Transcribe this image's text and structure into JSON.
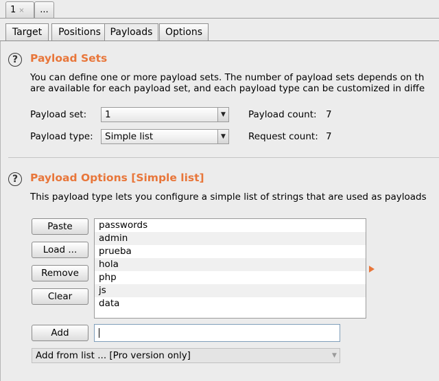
{
  "attack_tabs": [
    {
      "label": "1",
      "close": "×"
    },
    {
      "label": "..."
    }
  ],
  "tabs": [
    {
      "label": "Target"
    },
    {
      "label": "Positions"
    },
    {
      "label": "Payloads"
    },
    {
      "label": "Options"
    }
  ],
  "active_tab": "Payloads",
  "payload_sets": {
    "help_icon": "?",
    "title": "Payload Sets",
    "desc_line1": "You can define one or more payload sets. The number of payload sets depends on th",
    "desc_line2": "are available for each payload set, and each payload type can be customized in diffe",
    "set_label": "Payload set:",
    "set_value": "1",
    "type_label": "Payload type:",
    "type_value": "Simple list",
    "payload_count_label": "Payload count:",
    "payload_count": "7",
    "request_count_label": "Request count:",
    "request_count": "7"
  },
  "payload_options": {
    "help_icon": "?",
    "title": "Payload Options [Simple list]",
    "desc": "This payload type lets you configure a simple list of strings that are used as payloads",
    "buttons": {
      "paste": "Paste",
      "load": "Load ...",
      "remove": "Remove",
      "clear": "Clear",
      "add": "Add"
    },
    "items": [
      "passwords",
      "admin",
      "prueba",
      "hola",
      "php",
      "js",
      "data"
    ],
    "add_input_value": "",
    "add_from_list": "Add from list ... [Pro version only]"
  },
  "icons": {
    "dropdown": "chevron-down-icon",
    "help": "help-icon",
    "expand": "orange-arrow-icon"
  },
  "colors": {
    "accent": "#e8763a",
    "background": "#ececec"
  }
}
